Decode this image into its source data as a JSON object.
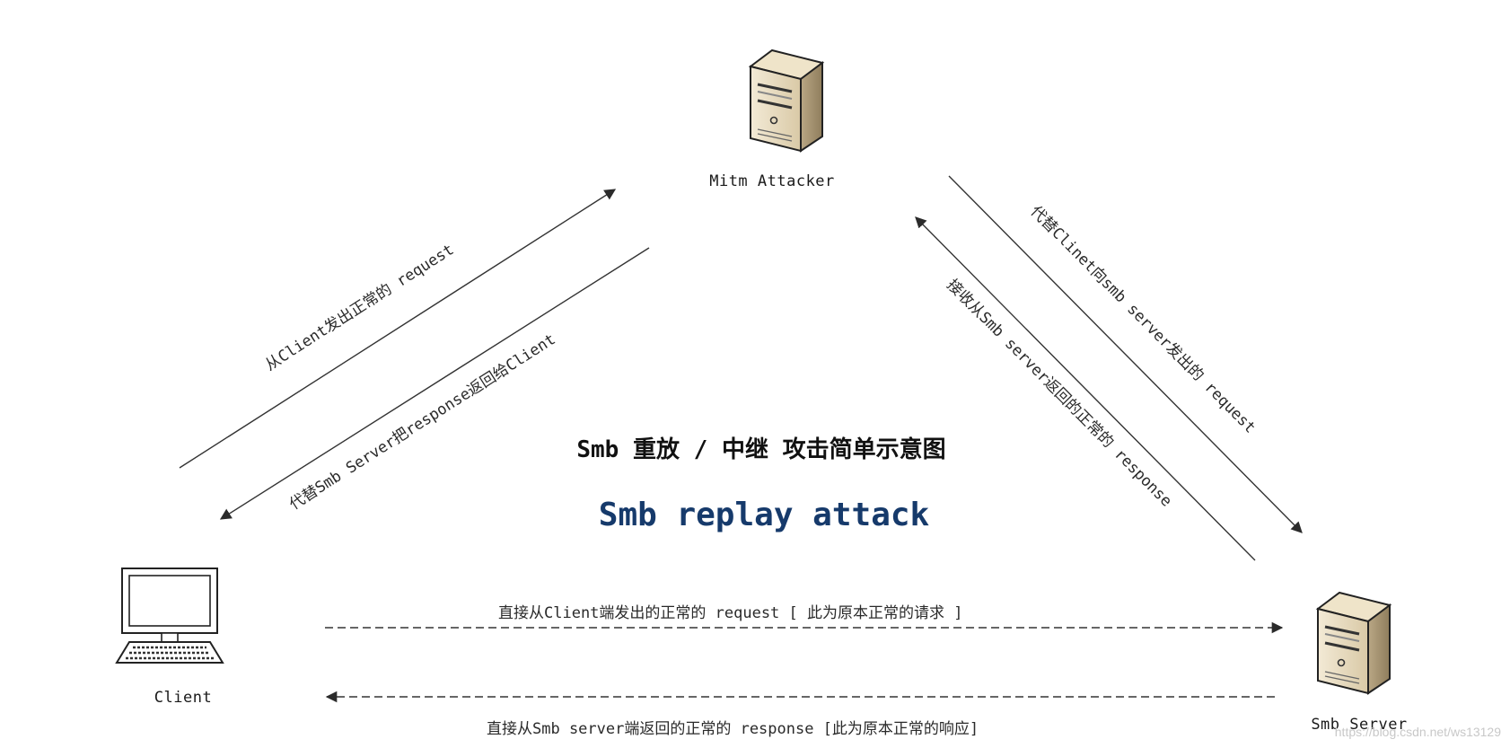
{
  "diagram": {
    "title_cn": "Smb 重放 / 中继 攻击简单示意图",
    "title_en": "Smb replay attack",
    "nodes": {
      "attacker": {
        "label": "Mitm Attacker",
        "icon": "server-tower-icon"
      },
      "client": {
        "label": "Client",
        "icon": "desktop-computer-icon"
      },
      "server": {
        "label": "Smb Server",
        "icon": "server-tower-icon"
      }
    },
    "edges": {
      "client_to_attacker": "从Client发出正常的 request",
      "attacker_to_client": "代替Smb Server把response返回给Client",
      "attacker_to_server": "代替Clinet向smb server发出的 request",
      "server_to_attacker": "接收从Smb server返回的正常的 response",
      "client_to_server": "直接从Client端发出的正常的 request [ 此为原本正常的请求 ]",
      "server_to_client": "直接从Smb server端返回的正常的 response [此为原本正常的响应]"
    },
    "watermark": "https://blog.csdn.net/ws13129"
  },
  "colors": {
    "line": "#333333",
    "title_en": "#163a6b",
    "server_body": "#e8dcc0",
    "server_shade": "#b9a785"
  }
}
